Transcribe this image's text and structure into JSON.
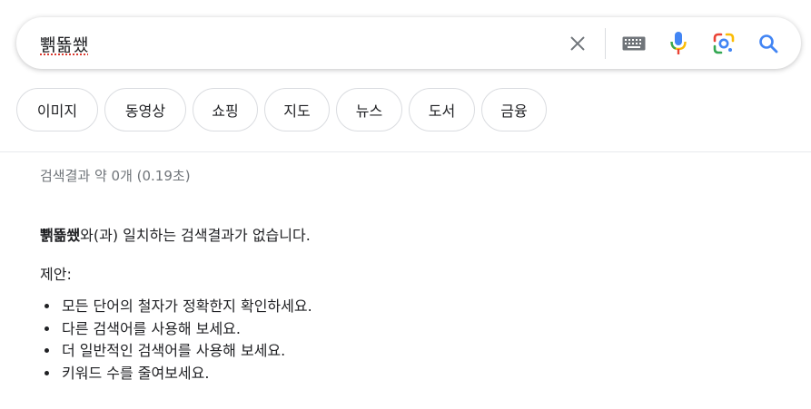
{
  "search": {
    "query": "뾁뚊쐤",
    "icons": {
      "clear": "close-icon",
      "keyboard": "keyboard-icon",
      "voice": "microphone-icon",
      "lens": "google-lens-icon",
      "search": "search-icon"
    }
  },
  "chips": [
    {
      "label": "이미지"
    },
    {
      "label": "동영상"
    },
    {
      "label": "쇼핑"
    },
    {
      "label": "지도"
    },
    {
      "label": "뉴스"
    },
    {
      "label": "도서"
    },
    {
      "label": "금융"
    }
  ],
  "results": {
    "stats": "검색결과 약 0개 (0.19초)",
    "no_match_query": "뾁뚊쐤",
    "no_match_suffix": "와(과) 일치하는 검색결과가 없습니다.",
    "suggestions_label": "제안:",
    "suggestions": [
      "모든 단어의 철자가 정확한지 확인하세요.",
      "다른 검색어를 사용해 보세요.",
      "더 일반적인 검색어를 사용해 보세요.",
      "키워드 수를 줄여보세요."
    ]
  },
  "colors": {
    "blue": "#4285f4",
    "red": "#ea4335",
    "yellow": "#fbbc05",
    "green": "#34a853",
    "gray_text": "#70757a"
  }
}
